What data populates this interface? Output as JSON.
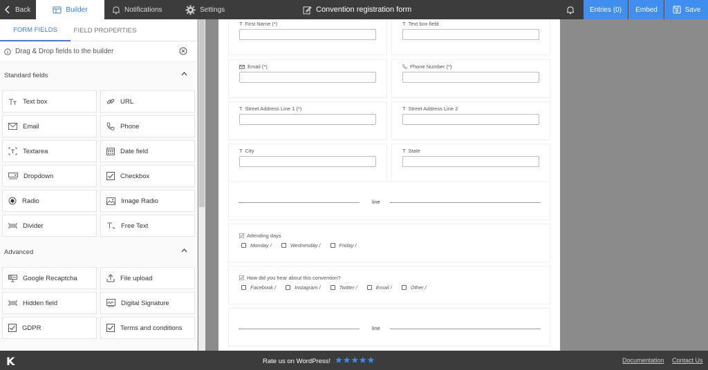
{
  "topbar": {
    "back": "Back",
    "builder": "Builder",
    "notifications": "Notifications",
    "settings": "Settings",
    "form_title": "Convention registration form",
    "entries": "Entries (0)",
    "embed": "Embed",
    "save": "Save"
  },
  "sidebar": {
    "tabs": [
      "FORM FIELDS",
      "FIELD PROPERTIES"
    ],
    "hint": "Drag & Drop fields to the builder",
    "standard_title": "Standard fields",
    "standard": [
      {
        "label": "Text box",
        "icon": "text-icon"
      },
      {
        "label": "URL",
        "icon": "link-icon"
      },
      {
        "label": "Email",
        "icon": "envelope-icon"
      },
      {
        "label": "Phone",
        "icon": "phone-icon"
      },
      {
        "label": "Textarea",
        "icon": "textarea-icon"
      },
      {
        "label": "Date field",
        "icon": "calendar-icon"
      },
      {
        "label": "Dropdown",
        "icon": "dropdown-icon"
      },
      {
        "label": "Checkbox",
        "icon": "checkbox-icon"
      },
      {
        "label": "Radio",
        "icon": "radio-icon"
      },
      {
        "label": "Image Radio",
        "icon": "image-icon"
      },
      {
        "label": "Divider",
        "icon": "divider-icon"
      },
      {
        "label": "Free Text",
        "icon": "free-text-icon"
      }
    ],
    "advanced_title": "Advanced",
    "advanced": [
      {
        "label": "Google Recaptcha",
        "icon": "recaptcha-icon"
      },
      {
        "label": "File upload",
        "icon": "upload-icon"
      },
      {
        "label": "Hidden field",
        "icon": "hidden-icon"
      },
      {
        "label": "Digital Signature",
        "icon": "signature-icon"
      },
      {
        "label": "GDPR",
        "icon": "checkbox-icon"
      },
      {
        "label": "Terms and conditions",
        "icon": "checkbox-icon"
      }
    ]
  },
  "form": {
    "fields": [
      [
        "First Name (*)",
        "Text box field"
      ],
      [
        "Email (*)",
        "Phone Number (*)"
      ],
      [
        "Street Address Line 1 (*)",
        "Street Address Line 2"
      ],
      [
        "City",
        "State"
      ]
    ],
    "divider_label": "line",
    "attending": {
      "question": "Attending days",
      "options": [
        "Monday /",
        "Wednesday /",
        "Friday /"
      ]
    },
    "source": {
      "question": "How did you hear about this convention?",
      "options": [
        "Facebook /",
        "Instagram /",
        "Twitter /",
        "Email /",
        "Other /"
      ]
    },
    "divider_label_2": "line"
  },
  "footer": {
    "logo": "K",
    "rate": "Rate us on WordPress!",
    "stars": "★★★★★",
    "documentation": "Documentation",
    "contact": "Contact Us"
  }
}
